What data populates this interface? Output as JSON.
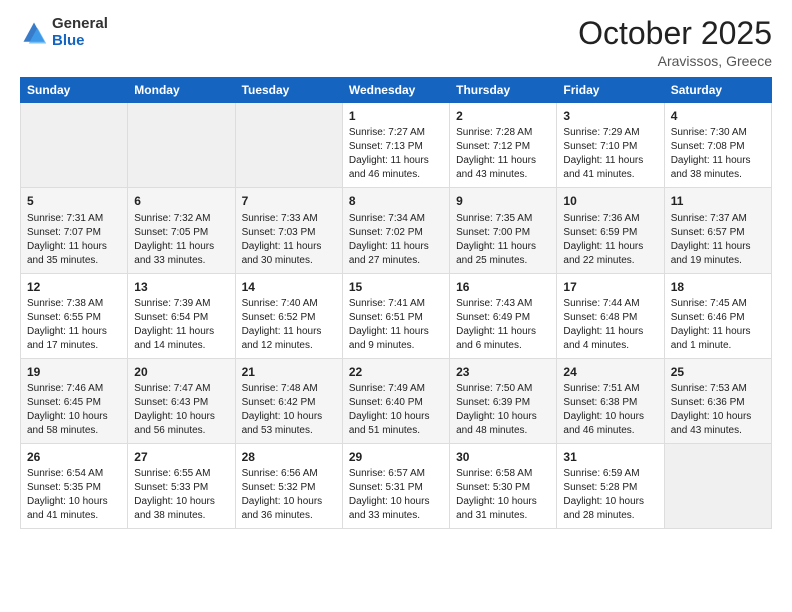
{
  "logo": {
    "general": "General",
    "blue": "Blue"
  },
  "title": "October 2025",
  "location": "Aravissos, Greece",
  "days_of_week": [
    "Sunday",
    "Monday",
    "Tuesday",
    "Wednesday",
    "Thursday",
    "Friday",
    "Saturday"
  ],
  "weeks": [
    [
      {
        "day": "",
        "sunrise": "",
        "sunset": "",
        "daylight": ""
      },
      {
        "day": "",
        "sunrise": "",
        "sunset": "",
        "daylight": ""
      },
      {
        "day": "",
        "sunrise": "",
        "sunset": "",
        "daylight": ""
      },
      {
        "day": "1",
        "sunrise": "Sunrise: 7:27 AM",
        "sunset": "Sunset: 7:13 PM",
        "daylight": "Daylight: 11 hours and 46 minutes."
      },
      {
        "day": "2",
        "sunrise": "Sunrise: 7:28 AM",
        "sunset": "Sunset: 7:12 PM",
        "daylight": "Daylight: 11 hours and 43 minutes."
      },
      {
        "day": "3",
        "sunrise": "Sunrise: 7:29 AM",
        "sunset": "Sunset: 7:10 PM",
        "daylight": "Daylight: 11 hours and 41 minutes."
      },
      {
        "day": "4",
        "sunrise": "Sunrise: 7:30 AM",
        "sunset": "Sunset: 7:08 PM",
        "daylight": "Daylight: 11 hours and 38 minutes."
      }
    ],
    [
      {
        "day": "5",
        "sunrise": "Sunrise: 7:31 AM",
        "sunset": "Sunset: 7:07 PM",
        "daylight": "Daylight: 11 hours and 35 minutes."
      },
      {
        "day": "6",
        "sunrise": "Sunrise: 7:32 AM",
        "sunset": "Sunset: 7:05 PM",
        "daylight": "Daylight: 11 hours and 33 minutes."
      },
      {
        "day": "7",
        "sunrise": "Sunrise: 7:33 AM",
        "sunset": "Sunset: 7:03 PM",
        "daylight": "Daylight: 11 hours and 30 minutes."
      },
      {
        "day": "8",
        "sunrise": "Sunrise: 7:34 AM",
        "sunset": "Sunset: 7:02 PM",
        "daylight": "Daylight: 11 hours and 27 minutes."
      },
      {
        "day": "9",
        "sunrise": "Sunrise: 7:35 AM",
        "sunset": "Sunset: 7:00 PM",
        "daylight": "Daylight: 11 hours and 25 minutes."
      },
      {
        "day": "10",
        "sunrise": "Sunrise: 7:36 AM",
        "sunset": "Sunset: 6:59 PM",
        "daylight": "Daylight: 11 hours and 22 minutes."
      },
      {
        "day": "11",
        "sunrise": "Sunrise: 7:37 AM",
        "sunset": "Sunset: 6:57 PM",
        "daylight": "Daylight: 11 hours and 19 minutes."
      }
    ],
    [
      {
        "day": "12",
        "sunrise": "Sunrise: 7:38 AM",
        "sunset": "Sunset: 6:55 PM",
        "daylight": "Daylight: 11 hours and 17 minutes."
      },
      {
        "day": "13",
        "sunrise": "Sunrise: 7:39 AM",
        "sunset": "Sunset: 6:54 PM",
        "daylight": "Daylight: 11 hours and 14 minutes."
      },
      {
        "day": "14",
        "sunrise": "Sunrise: 7:40 AM",
        "sunset": "Sunset: 6:52 PM",
        "daylight": "Daylight: 11 hours and 12 minutes."
      },
      {
        "day": "15",
        "sunrise": "Sunrise: 7:41 AM",
        "sunset": "Sunset: 6:51 PM",
        "daylight": "Daylight: 11 hours and 9 minutes."
      },
      {
        "day": "16",
        "sunrise": "Sunrise: 7:43 AM",
        "sunset": "Sunset: 6:49 PM",
        "daylight": "Daylight: 11 hours and 6 minutes."
      },
      {
        "day": "17",
        "sunrise": "Sunrise: 7:44 AM",
        "sunset": "Sunset: 6:48 PM",
        "daylight": "Daylight: 11 hours and 4 minutes."
      },
      {
        "day": "18",
        "sunrise": "Sunrise: 7:45 AM",
        "sunset": "Sunset: 6:46 PM",
        "daylight": "Daylight: 11 hours and 1 minute."
      }
    ],
    [
      {
        "day": "19",
        "sunrise": "Sunrise: 7:46 AM",
        "sunset": "Sunset: 6:45 PM",
        "daylight": "Daylight: 10 hours and 58 minutes."
      },
      {
        "day": "20",
        "sunrise": "Sunrise: 7:47 AM",
        "sunset": "Sunset: 6:43 PM",
        "daylight": "Daylight: 10 hours and 56 minutes."
      },
      {
        "day": "21",
        "sunrise": "Sunrise: 7:48 AM",
        "sunset": "Sunset: 6:42 PM",
        "daylight": "Daylight: 10 hours and 53 minutes."
      },
      {
        "day": "22",
        "sunrise": "Sunrise: 7:49 AM",
        "sunset": "Sunset: 6:40 PM",
        "daylight": "Daylight: 10 hours and 51 minutes."
      },
      {
        "day": "23",
        "sunrise": "Sunrise: 7:50 AM",
        "sunset": "Sunset: 6:39 PM",
        "daylight": "Daylight: 10 hours and 48 minutes."
      },
      {
        "day": "24",
        "sunrise": "Sunrise: 7:51 AM",
        "sunset": "Sunset: 6:38 PM",
        "daylight": "Daylight: 10 hours and 46 minutes."
      },
      {
        "day": "25",
        "sunrise": "Sunrise: 7:53 AM",
        "sunset": "Sunset: 6:36 PM",
        "daylight": "Daylight: 10 hours and 43 minutes."
      }
    ],
    [
      {
        "day": "26",
        "sunrise": "Sunrise: 6:54 AM",
        "sunset": "Sunset: 5:35 PM",
        "daylight": "Daylight: 10 hours and 41 minutes."
      },
      {
        "day": "27",
        "sunrise": "Sunrise: 6:55 AM",
        "sunset": "Sunset: 5:33 PM",
        "daylight": "Daylight: 10 hours and 38 minutes."
      },
      {
        "day": "28",
        "sunrise": "Sunrise: 6:56 AM",
        "sunset": "Sunset: 5:32 PM",
        "daylight": "Daylight: 10 hours and 36 minutes."
      },
      {
        "day": "29",
        "sunrise": "Sunrise: 6:57 AM",
        "sunset": "Sunset: 5:31 PM",
        "daylight": "Daylight: 10 hours and 33 minutes."
      },
      {
        "day": "30",
        "sunrise": "Sunrise: 6:58 AM",
        "sunset": "Sunset: 5:30 PM",
        "daylight": "Daylight: 10 hours and 31 minutes."
      },
      {
        "day": "31",
        "sunrise": "Sunrise: 6:59 AM",
        "sunset": "Sunset: 5:28 PM",
        "daylight": "Daylight: 10 hours and 28 minutes."
      },
      {
        "day": "",
        "sunrise": "",
        "sunset": "",
        "daylight": ""
      }
    ]
  ]
}
